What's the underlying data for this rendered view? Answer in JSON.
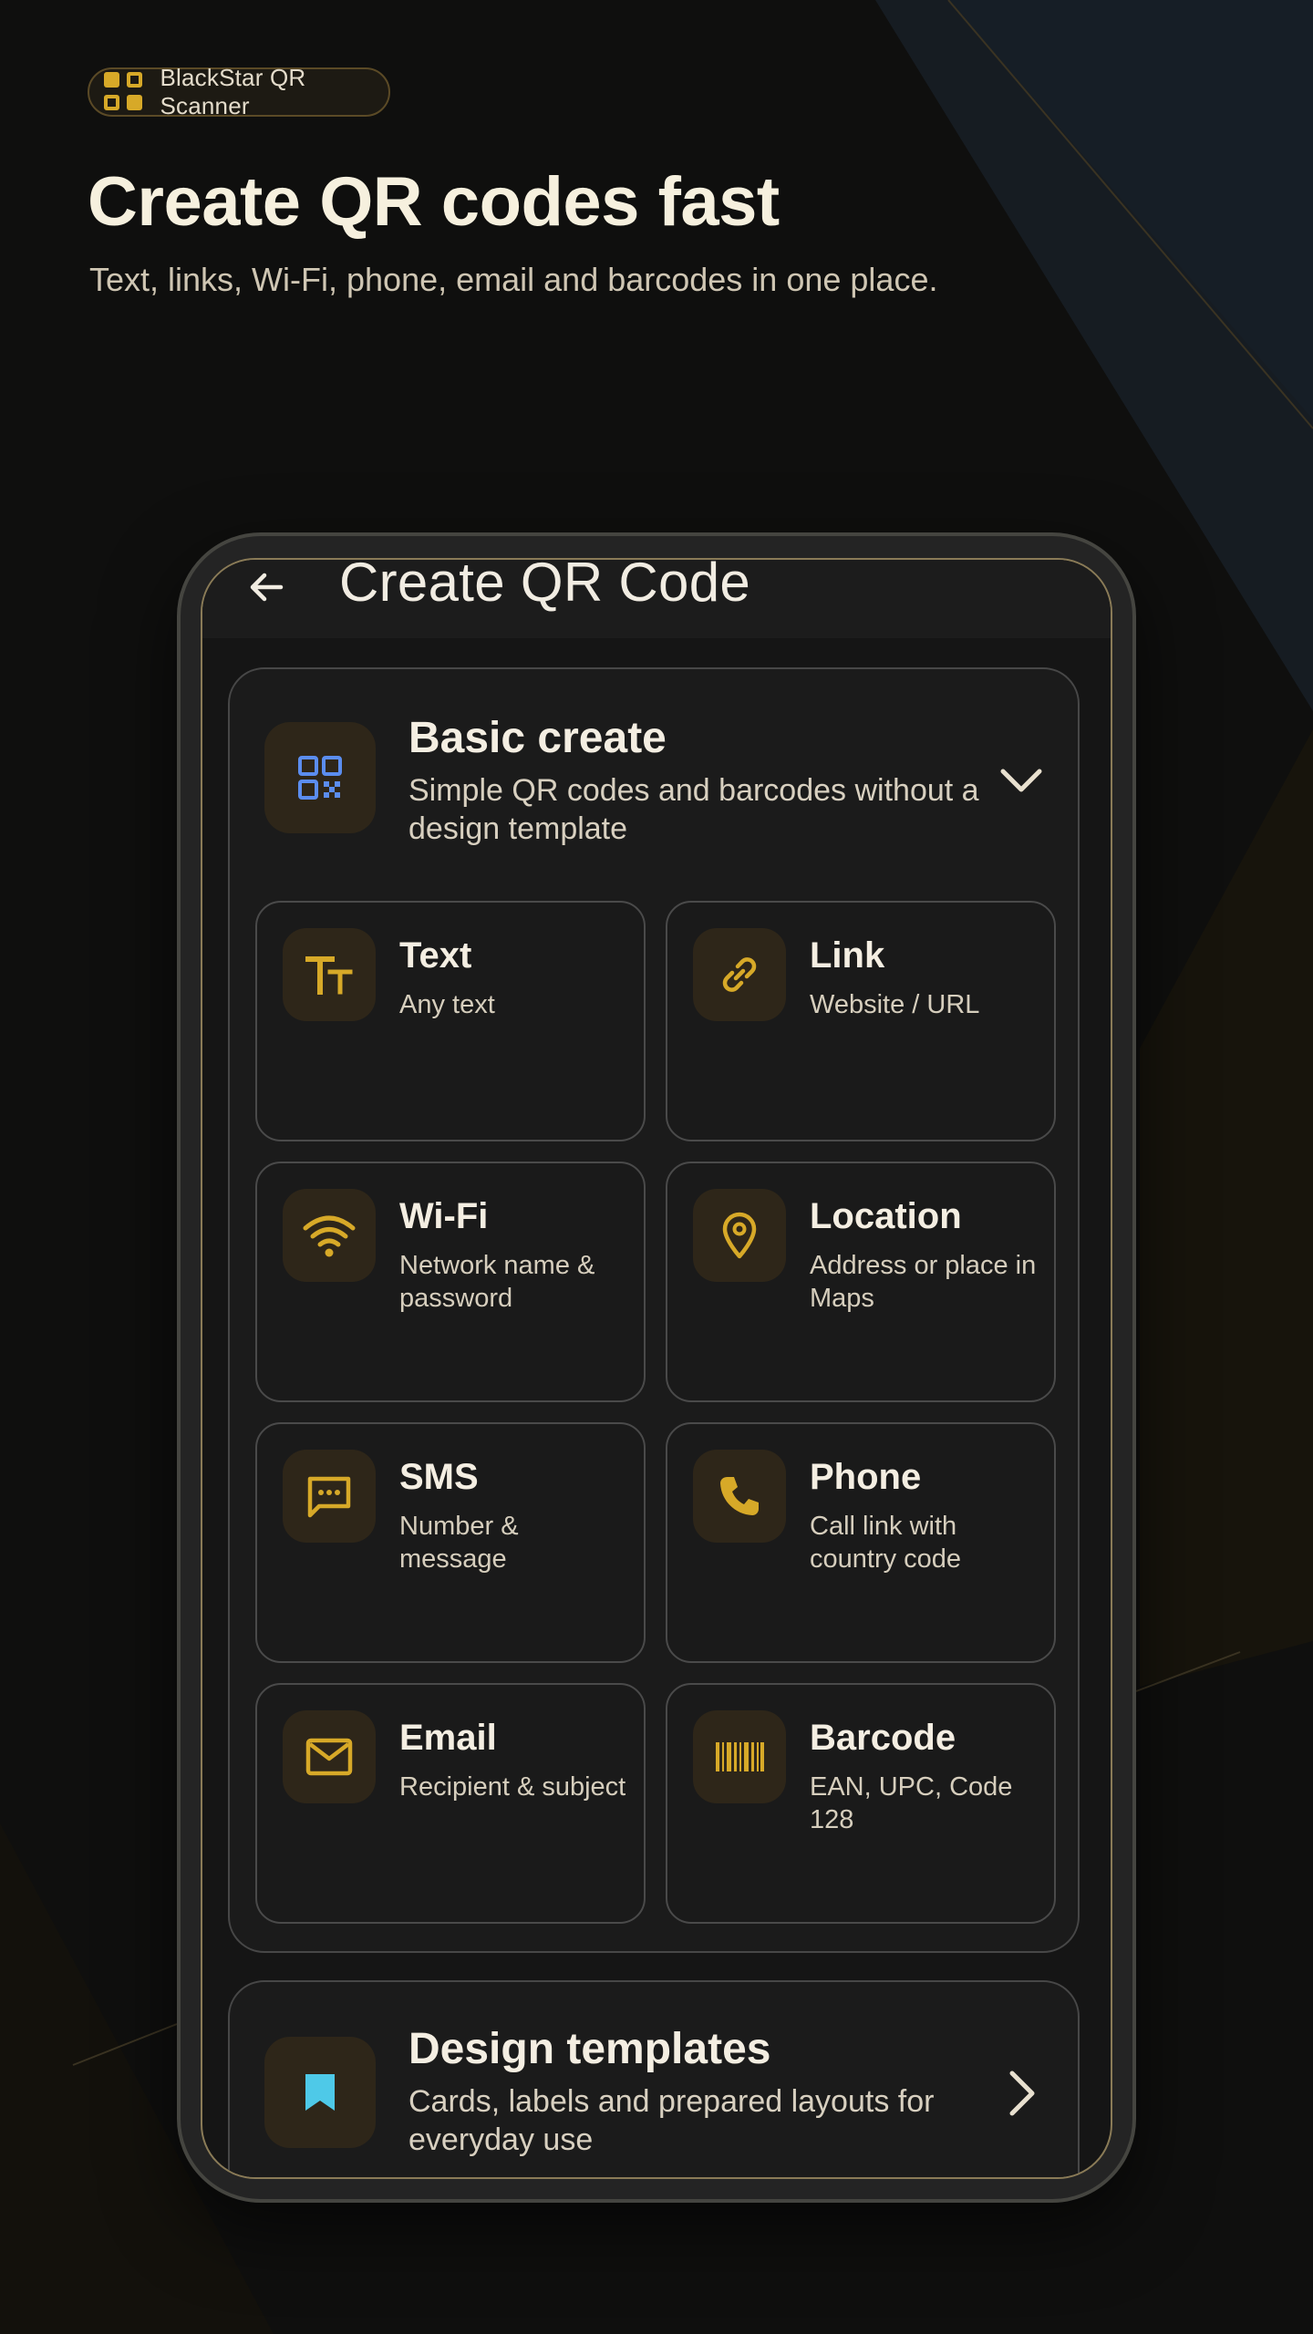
{
  "brand": {
    "name": "BlackStar QR Scanner",
    "accent": "#d7a928"
  },
  "hero": {
    "title": "Create QR codes fast",
    "subtitle": "Text, links, Wi-Fi, phone, email and barcodes in one place."
  },
  "app": {
    "title": "Create QR Code",
    "back_icon": "arrow-left-icon",
    "basic": {
      "title": "Basic create",
      "description": "Simple QR codes and barcodes without a design template",
      "icon": "qr-code-icon",
      "toggle_icon": "chevron-down-icon",
      "items": [
        {
          "title": "Text",
          "subtitle": "Any text",
          "icon": "text-format-icon"
        },
        {
          "title": "Link",
          "subtitle": "Website / URL",
          "icon": "link-icon"
        },
        {
          "title": "Wi-Fi",
          "subtitle": "Network name & password",
          "icon": "wifi-icon"
        },
        {
          "title": "Location",
          "subtitle": "Address or place in Maps",
          "icon": "location-pin-icon"
        },
        {
          "title": "SMS",
          "subtitle": "Number & message",
          "icon": "sms-icon"
        },
        {
          "title": "Phone",
          "subtitle": "Call link with country code",
          "icon": "phone-icon"
        },
        {
          "title": "Email",
          "subtitle": "Recipient & subject",
          "icon": "email-icon"
        },
        {
          "title": "Barcode",
          "subtitle": "EAN, UPC, Code 128",
          "icon": "barcode-icon"
        }
      ]
    },
    "design": {
      "title": "Design templates",
      "description": "Cards, labels and prepared layouts for everyday use",
      "icon": "bookmark-icon",
      "nav_icon": "chevron-right-icon"
    }
  },
  "colors": {
    "background": "#0f0f0e",
    "card": "#1b1b1b",
    "icon_tile": "#2e2619",
    "gold": "#d7a928",
    "qr_blue": "#5b8def",
    "bookmark_cyan": "#4ec9e8"
  }
}
